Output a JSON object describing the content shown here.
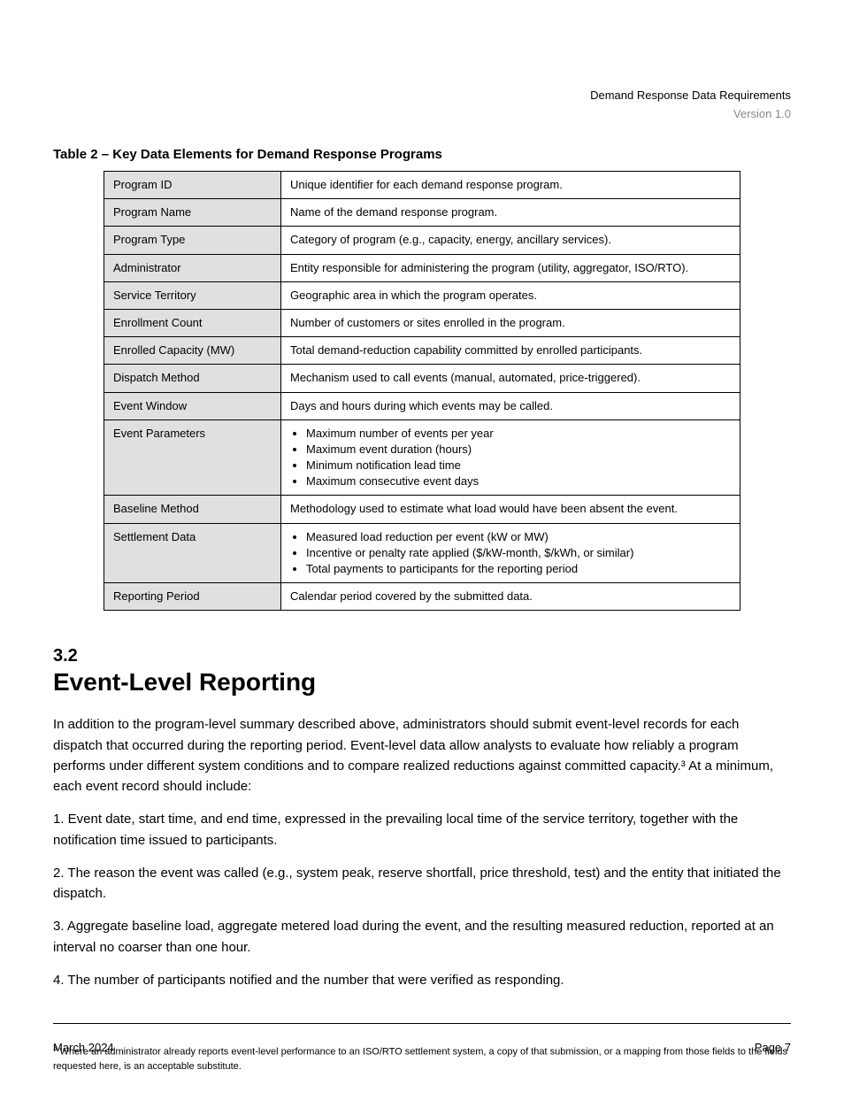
{
  "header": {
    "title": "Demand Response Data Requirements",
    "version": "Version 1.0"
  },
  "table": {
    "title": "Table 2 – Key Data Elements for Demand Response Programs",
    "rows": [
      {
        "label": "Program ID",
        "value": "Unique identifier for each demand response program."
      },
      {
        "label": "Program Name",
        "value": "Name of the demand response program."
      },
      {
        "label": "Program Type",
        "value": "Category of program (e.g., capacity, energy, ancillary services)."
      },
      {
        "label": "Administrator",
        "value": "Entity responsible for administering the program (utility, aggregator, ISO/RTO)."
      },
      {
        "label": "Service Territory",
        "value": "Geographic area in which the program operates."
      },
      {
        "label": "Enrollment Count",
        "value": "Number of customers or sites enrolled in the program."
      },
      {
        "label": "Enrolled Capacity (MW)",
        "value": "Total demand-reduction capability committed by enrolled participants.",
        "thick_top": true
      },
      {
        "label": "Dispatch Method",
        "value": "Mechanism used to call events (manual, automated, price-triggered)."
      },
      {
        "label": "Event Window",
        "value": "Days and hours during which events may be called."
      },
      {
        "label": "Event Parameters",
        "bullets": [
          "Maximum number of events per year",
          "Maximum event duration (hours)",
          "Minimum notification lead time",
          "Maximum consecutive event days"
        ]
      },
      {
        "label": "Baseline Method",
        "value": "Methodology used to estimate what load would have been absent the event."
      },
      {
        "label": "Settlement Data",
        "bullets": [
          "Measured load reduction per event (kW or MW)",
          "Incentive or penalty rate applied ($/kW-month, $/kWh, or similar)",
          "Total payments to participants for the reporting period"
        ]
      },
      {
        "label": "Reporting Period",
        "value": "Calendar period covered by the submitted data."
      }
    ]
  },
  "section": {
    "number": "3.2",
    "title": "Event-Level Reporting",
    "para1": "In addition to the program-level summary described above, administrators should submit event-level records for each dispatch that occurred during the reporting period. Event-level data allow analysts to evaluate how reliably a program performs under different system conditions and to compare realized reductions against committed capacity.³ At a minimum, each event record should include:",
    "items": [
      "1.   Event date, start time, and end time, expressed in the prevailing local time of the service territory, together with the notification time issued to participants.",
      "2.   The reason the event was called (e.g., system peak, reserve shortfall, price threshold, test) and the entity that initiated the dispatch.",
      "3.   Aggregate baseline load, aggregate metered load during the event, and the resulting measured reduction, reported at an interval no coarser than one hour.",
      "4.   The number of participants notified and the number that were verified as responding."
    ]
  },
  "footnote": {
    "num": "3",
    "text": "Where an administrator already reports event-level performance to an ISO/RTO settlement system, a copy of that submission, or a mapping from those fields to the fields requested here, is an acceptable substitute."
  },
  "footer": {
    "left": "March 2024",
    "right": "Page 7"
  }
}
